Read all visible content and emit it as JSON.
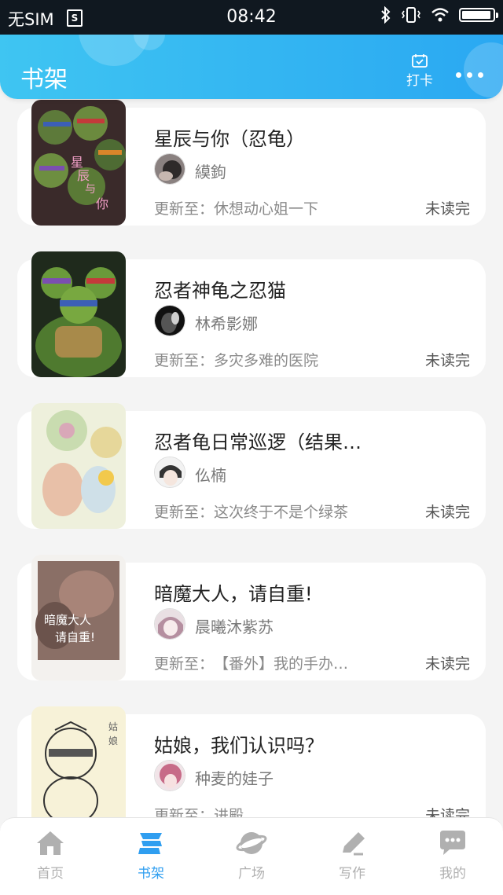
{
  "status_bar": {
    "carrier": "无SIM",
    "sim_icon": "S",
    "time": "08:42",
    "icons": [
      "bluetooth-icon",
      "vibrate-icon",
      "wifi-icon",
      "battery-icon"
    ],
    "battery_level": 0.95
  },
  "header": {
    "title": "书架",
    "checkin_label": "打卡",
    "more_icon": "more-dots-icon",
    "gradient": [
      "#3fc5f2",
      "#2aa8f2"
    ]
  },
  "books": [
    {
      "title": "星辰与你（忍龟）",
      "author": "縸鉤",
      "update_prefix": "更新至：",
      "chapter": "休想动心姐一下",
      "status": "未读完"
    },
    {
      "title": "忍者神龟之忍猫",
      "author": "林希影娜",
      "update_prefix": "更新至：",
      "chapter": "多灾多难的医院",
      "status": "未读完"
    },
    {
      "title": "忍者龟日常巡逻（结果…",
      "author": "仫楠",
      "update_prefix": "更新至：",
      "chapter": "这次终于不是个绿茶",
      "status": "未读完"
    },
    {
      "title": "暗魔大人，请自重!",
      "author": "晨曦沐紫苏",
      "update_prefix": "更新至：",
      "chapter": "【番外】我的手办…",
      "status": "未读完"
    },
    {
      "title": "姑娘，我们认识吗？",
      "author": "种麦的娃子",
      "update_prefix": "更新至：",
      "chapter": "进殿",
      "status": "未读完"
    }
  ],
  "nav": {
    "items": [
      {
        "label": "首页",
        "icon": "home-icon"
      },
      {
        "label": "书架",
        "icon": "bookshelf-icon"
      },
      {
        "label": "广场",
        "icon": "planet-icon"
      },
      {
        "label": "写作",
        "icon": "pen-icon"
      },
      {
        "label": "我的",
        "icon": "chat-bubble-icon"
      }
    ],
    "active": "书架",
    "active_color": "#2f9ef0",
    "inactive_color": "#b0b0b0"
  }
}
